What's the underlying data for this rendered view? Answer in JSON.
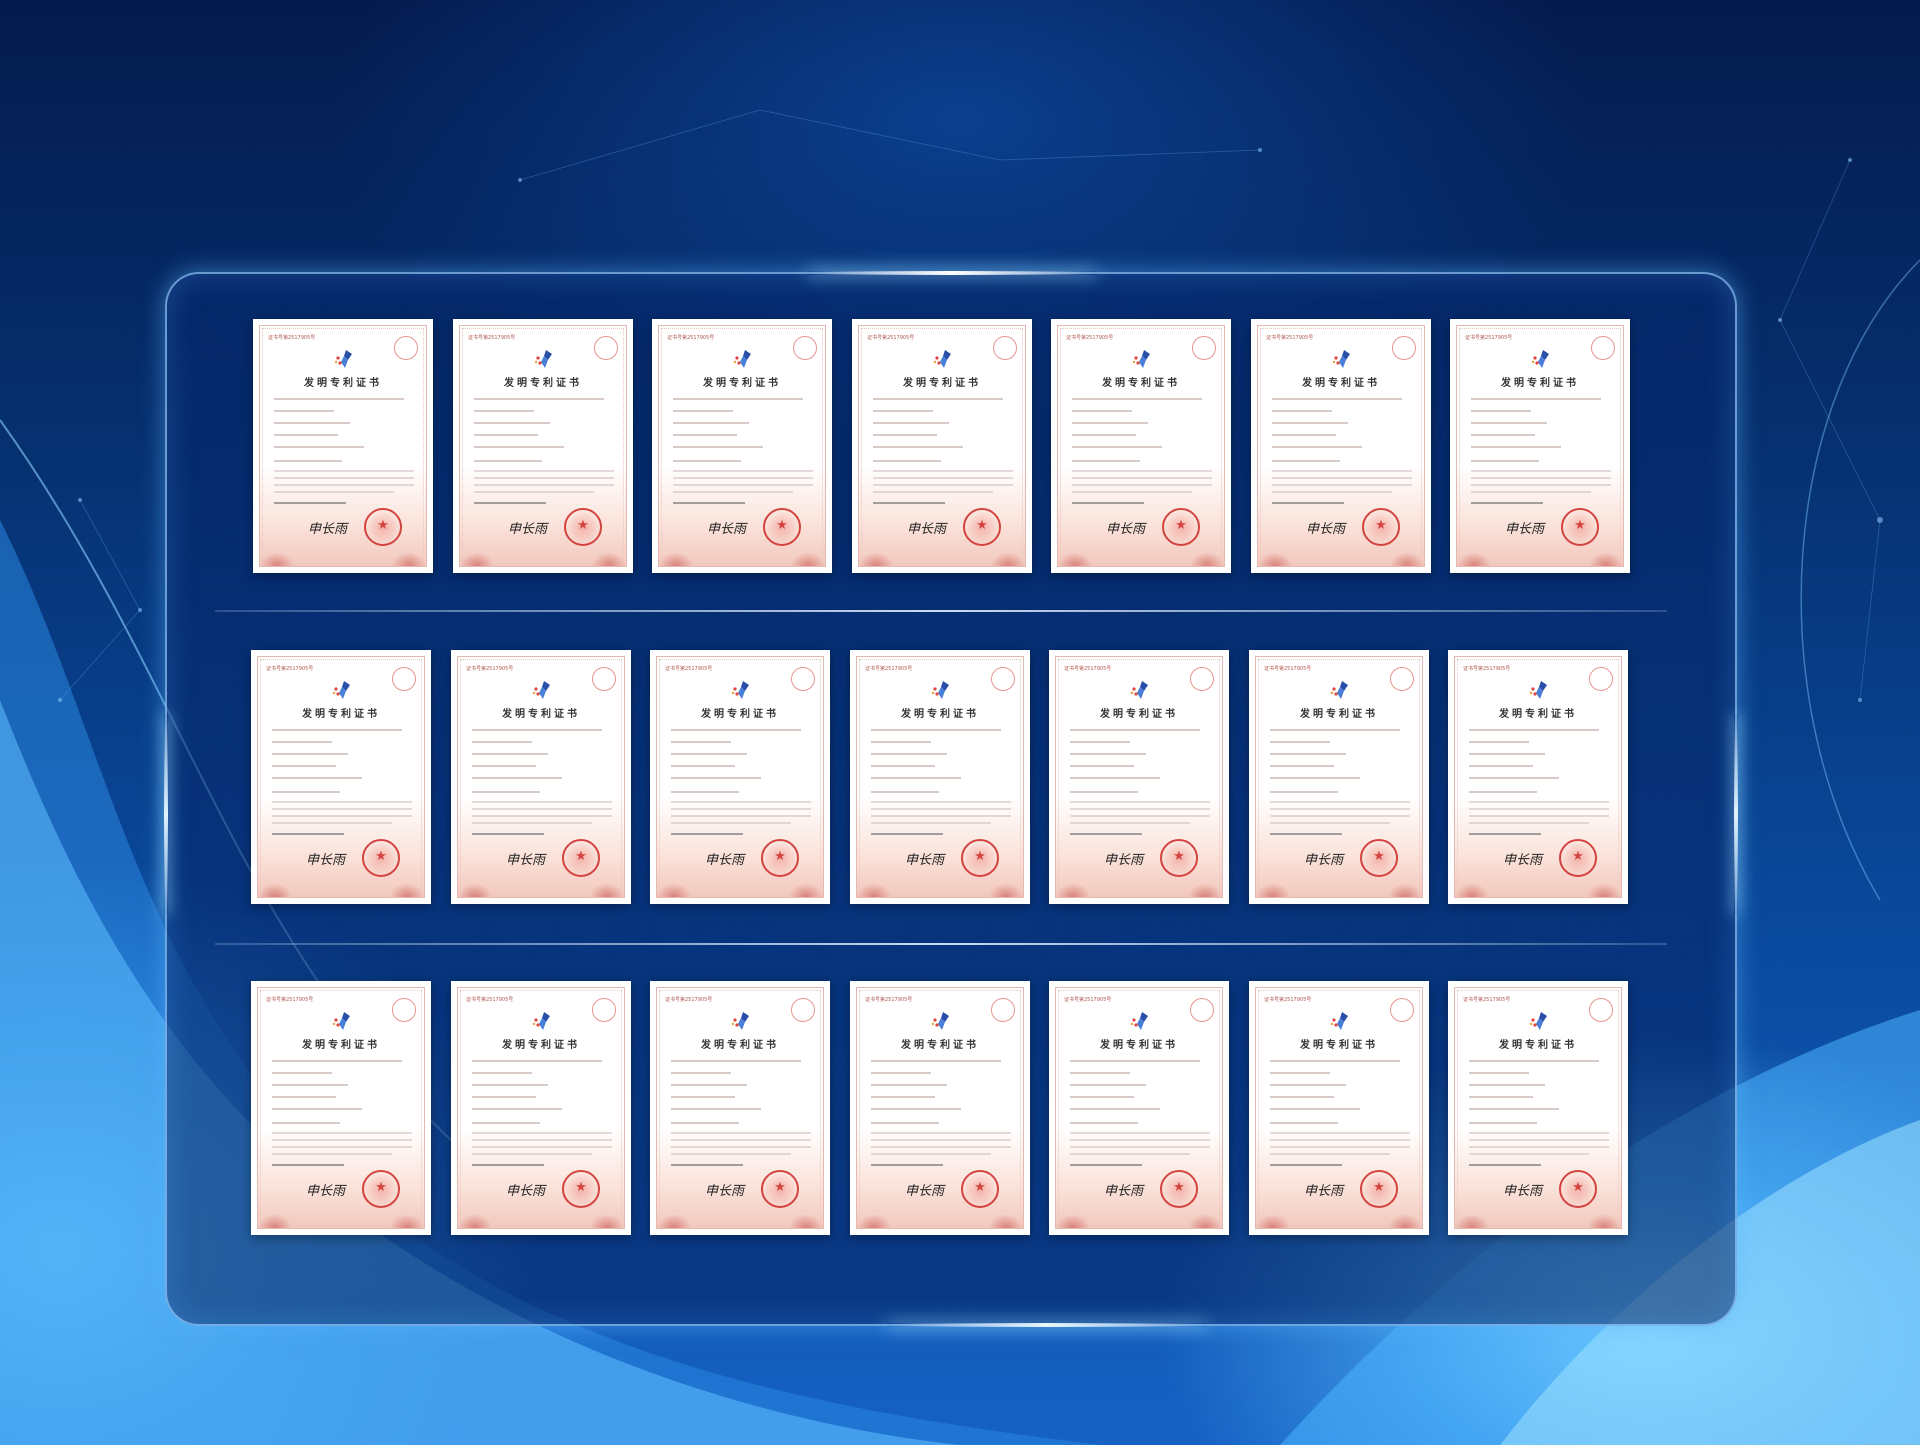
{
  "page": {
    "accent_color": "#9fe0ff",
    "frame_color": "#96cdff"
  },
  "certificate": {
    "title": "发明专利证书",
    "number_label": "证书号第2517905号",
    "signature": "申长雨",
    "logo_icon": "patent-office-logo-icon",
    "seal_icon": "national-emblem-seal-icon",
    "stamp_icon": "qr-stamp-icon",
    "colors": {
      "seal": "#d4433f",
      "border": "#e4b8b0",
      "gradient_bottom": "#f2c8bd"
    }
  },
  "grid": {
    "rows": 3,
    "columns": 7
  }
}
